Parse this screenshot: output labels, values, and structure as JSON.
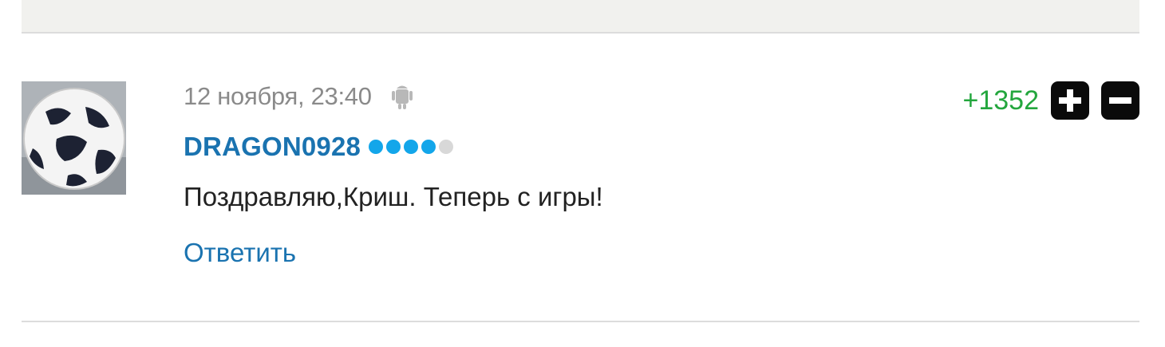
{
  "comment": {
    "date": "12 ноября, 23:40",
    "device_icon": "android-icon",
    "author": "DRAGON0928",
    "rating_level": 4,
    "rating_max": 5,
    "text": "Поздравляю,Криш. Теперь с игры!",
    "reply_label": "Ответить",
    "score": "+1352",
    "upvote_icon": "plus-icon",
    "downvote_icon": "minus-icon",
    "avatar_icon": "soccer-ball-avatar"
  },
  "colors": {
    "author": "#1a73b0",
    "score": "#23a63d",
    "rating_on": "#13a6ea",
    "rating_off": "#d8d8d8",
    "vote_button": "#0a0a0a"
  }
}
